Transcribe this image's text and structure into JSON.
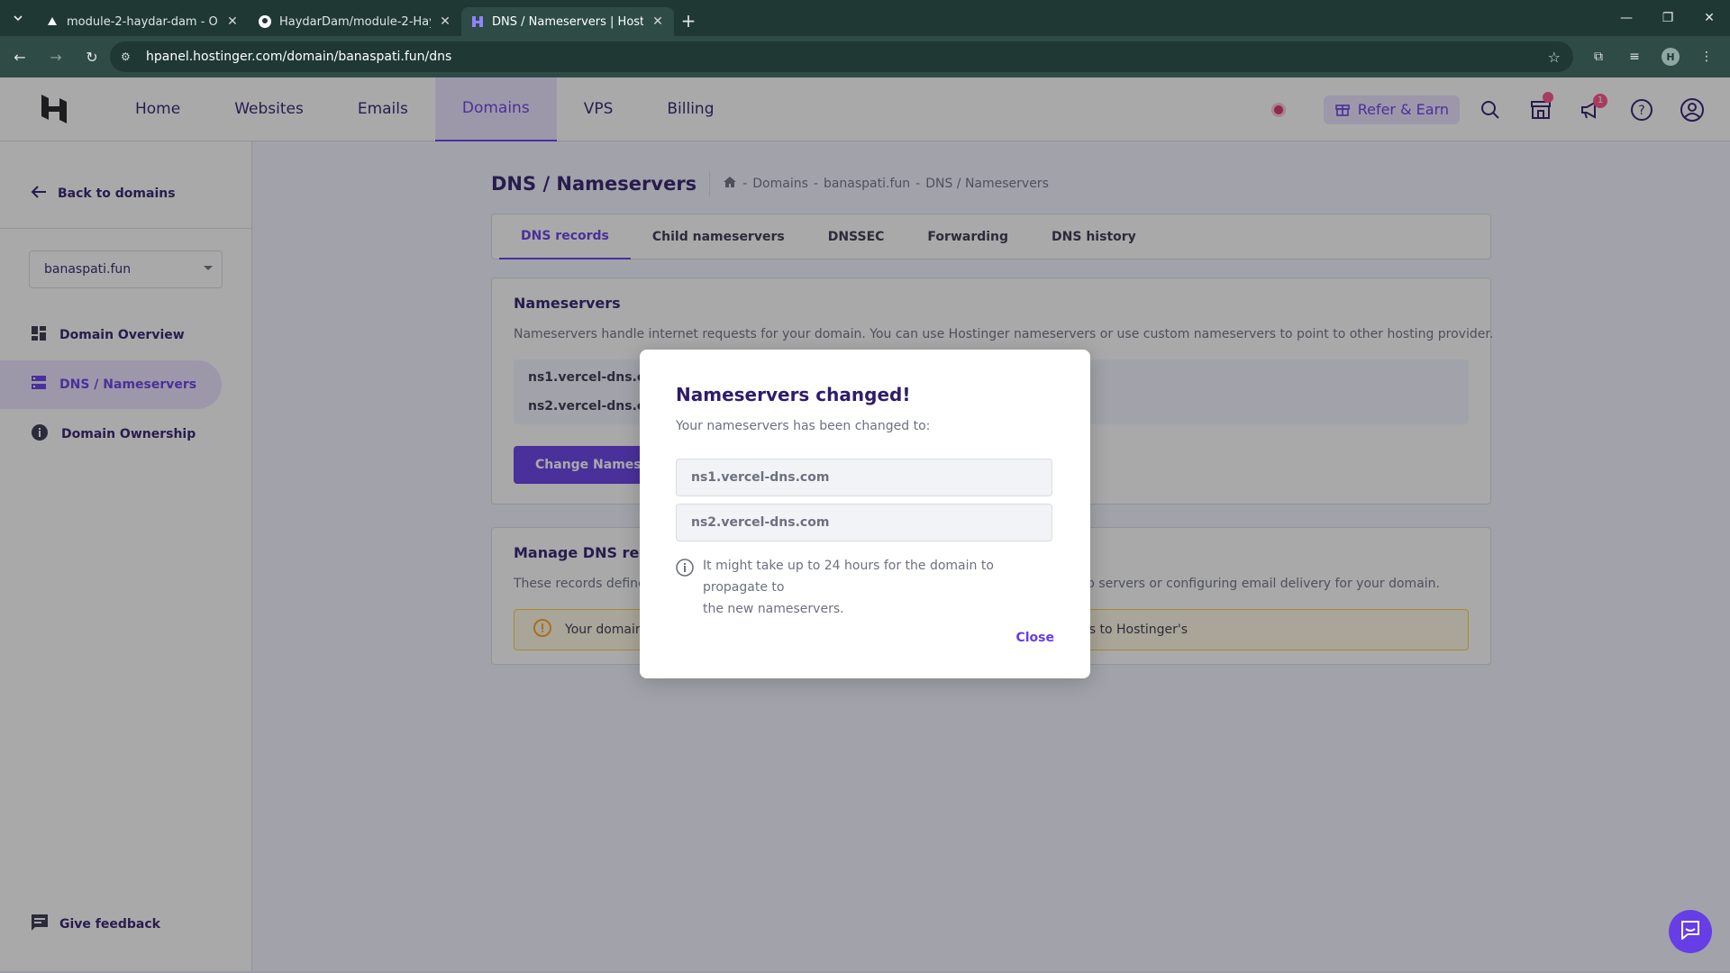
{
  "browser": {
    "tabs": [
      {
        "title": "module-2-haydar-dam - Overview",
        "active": false
      },
      {
        "title": "HaydarDam/module-2-HaydarDam",
        "active": false
      },
      {
        "title": "DNS / Nameservers | Hostinger",
        "active": true
      }
    ],
    "url": "hpanel.hostinger.com/domain/banaspati.fun/dns",
    "profile_initial": "H"
  },
  "header": {
    "nav": [
      "Home",
      "Websites",
      "Emails",
      "Domains",
      "VPS",
      "Billing"
    ],
    "active_nav": "Domains",
    "refer_label": "Refer & Earn",
    "notification_count": "1"
  },
  "sidebar": {
    "back_label": "Back to domains",
    "domain_selected": "banaspati.fun",
    "items": [
      {
        "label": "Domain Overview",
        "icon": "dashboard-icon"
      },
      {
        "label": "DNS / Nameservers",
        "icon": "dns-icon",
        "active": true
      },
      {
        "label": "Domain Ownership",
        "icon": "info-icon"
      }
    ],
    "feedback_label": "Give feedback"
  },
  "main": {
    "title": "DNS / Nameservers",
    "breadcrumb": [
      "Domains",
      "banaspati.fun",
      "DNS / Nameservers"
    ],
    "tabs": [
      "DNS records",
      "Child nameservers",
      "DNSSEC",
      "Forwarding",
      "DNS history"
    ],
    "active_tab": "DNS records",
    "nameservers": {
      "title": "Nameservers",
      "description": "Nameservers handle internet requests for your domain. You can use Hostinger nameservers or use custom nameservers to point to other hosting provider.",
      "ns1": "ns1.vercel-dns.com",
      "ns2": "ns2.vercel-dns.com",
      "button": "Change Nameservers"
    },
    "manage": {
      "title": "Manage DNS records",
      "desc_left": "These records define",
      "desc_right": "b servers or configuring email delivery for your domain.",
      "warn_left": "Your domain",
      "warn_right": "rs to Hostinger's"
    }
  },
  "modal": {
    "title": "Nameservers changed!",
    "subtitle": "Your nameservers has been changed to:",
    "ns1": "ns1.vercel-dns.com",
    "ns2": "ns2.vercel-dns.com",
    "info_line1": "It might take up to 24 hours for the domain to propagate to",
    "info_line2": "the new nameservers.",
    "close_label": "Close"
  },
  "colors": {
    "accent": "#673de6",
    "accent_light": "#ebe4ff",
    "browser_dark": "#1f3833"
  }
}
